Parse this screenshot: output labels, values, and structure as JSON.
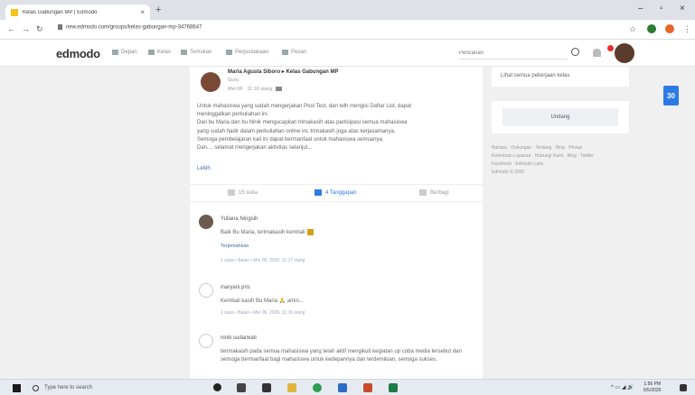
{
  "browser": {
    "tab_title": "Kelas Gabungan MP | Edmodo",
    "url": "new.edmodo.com/groups/kelas-gabungan-mp-34768647"
  },
  "site": {
    "logo": "edmodo",
    "nav": [
      {
        "label": "Depan",
        "icon": "home-icon"
      },
      {
        "label": "Kelas",
        "icon": "grid-icon"
      },
      {
        "label": "Temukan",
        "icon": "compass-icon"
      },
      {
        "label": "Perpustakaan",
        "icon": "library-icon"
      },
      {
        "label": "Pesan",
        "icon": "message-icon"
      }
    ],
    "search_placeholder": "Pencarian"
  },
  "post": {
    "author": "Maria Agusta Siboro ▸ Kelas Gabungan MP",
    "role": "Guru",
    "time": "Mei 06 · 11:16 siang",
    "body_lines": [
      "Untuk mahasiswa yang sudah mengerjakan Post Test, dan telh mengisi Daftar List, dapat",
      "meninggalkan perkuliahan ini.",
      "Dari bu Maria dan bu Ninik mengucapkan trimakasih atas partisipasi semua mahasiswa",
      "yang sudah hadir dalam perkuliahan online ini, trimakasih juga atas kerjasamanya.",
      "Semoga pembelajaran kali ini dapat bermanfaat untuk mahasiswa semuanya.",
      "Dan.... selamat mengerjakan aktivitas selanjut..."
    ],
    "more": "Lebih",
    "actions": {
      "like": "15 suka",
      "reply": "4 Tanggapan",
      "share": "Berbagi"
    }
  },
  "comments": [
    {
      "name": "Yuliana Ningsih",
      "text": "Baik Bu Maria, terimakasih kembali",
      "translate": "Terjemahkan",
      "meta": "1 suka • Balas • Mei 06, 2020, 11:17 siang",
      "avatar": "photo"
    },
    {
      "name": "maryani pris",
      "text": "Kembali kasih Bu Maria 🙏 amin...",
      "translate": "",
      "meta": "1 suka • Balas • Mei 06, 2020, 11:16 siang",
      "avatar": "default"
    },
    {
      "name": "ninik sudarwati",
      "text": "terimakasih pada semua mahasiswa yang telah aktif mengikuti kegiatan up coba media tersebut dan semoga bermanfaat bagi mahasiswa untuk kedepannya dan terdemikian, semoga sukses.",
      "translate": "",
      "meta": "",
      "avatar": "default"
    }
  ],
  "right": {
    "see_all_link": "Lihat semua pekerjaan kelas",
    "calendar_day": "30",
    "invite_label": "Undang",
    "footer_lines": [
      "Bahasa · Dukungan · Tentang · Blog · Privasi",
      "Ketentuan Layanan · Hubungi Kami · Blog · Twitter",
      "Facebook · Edmodo Labs",
      "Edmodo © 2020"
    ]
  },
  "taskbar": {
    "search_placeholder": "Type here to search",
    "time": "1:56 PM",
    "date": "6/5/2020"
  },
  "colors": {
    "accent": "#2c7be5",
    "link": "#3a6ea5",
    "notification": "#e8312a"
  }
}
